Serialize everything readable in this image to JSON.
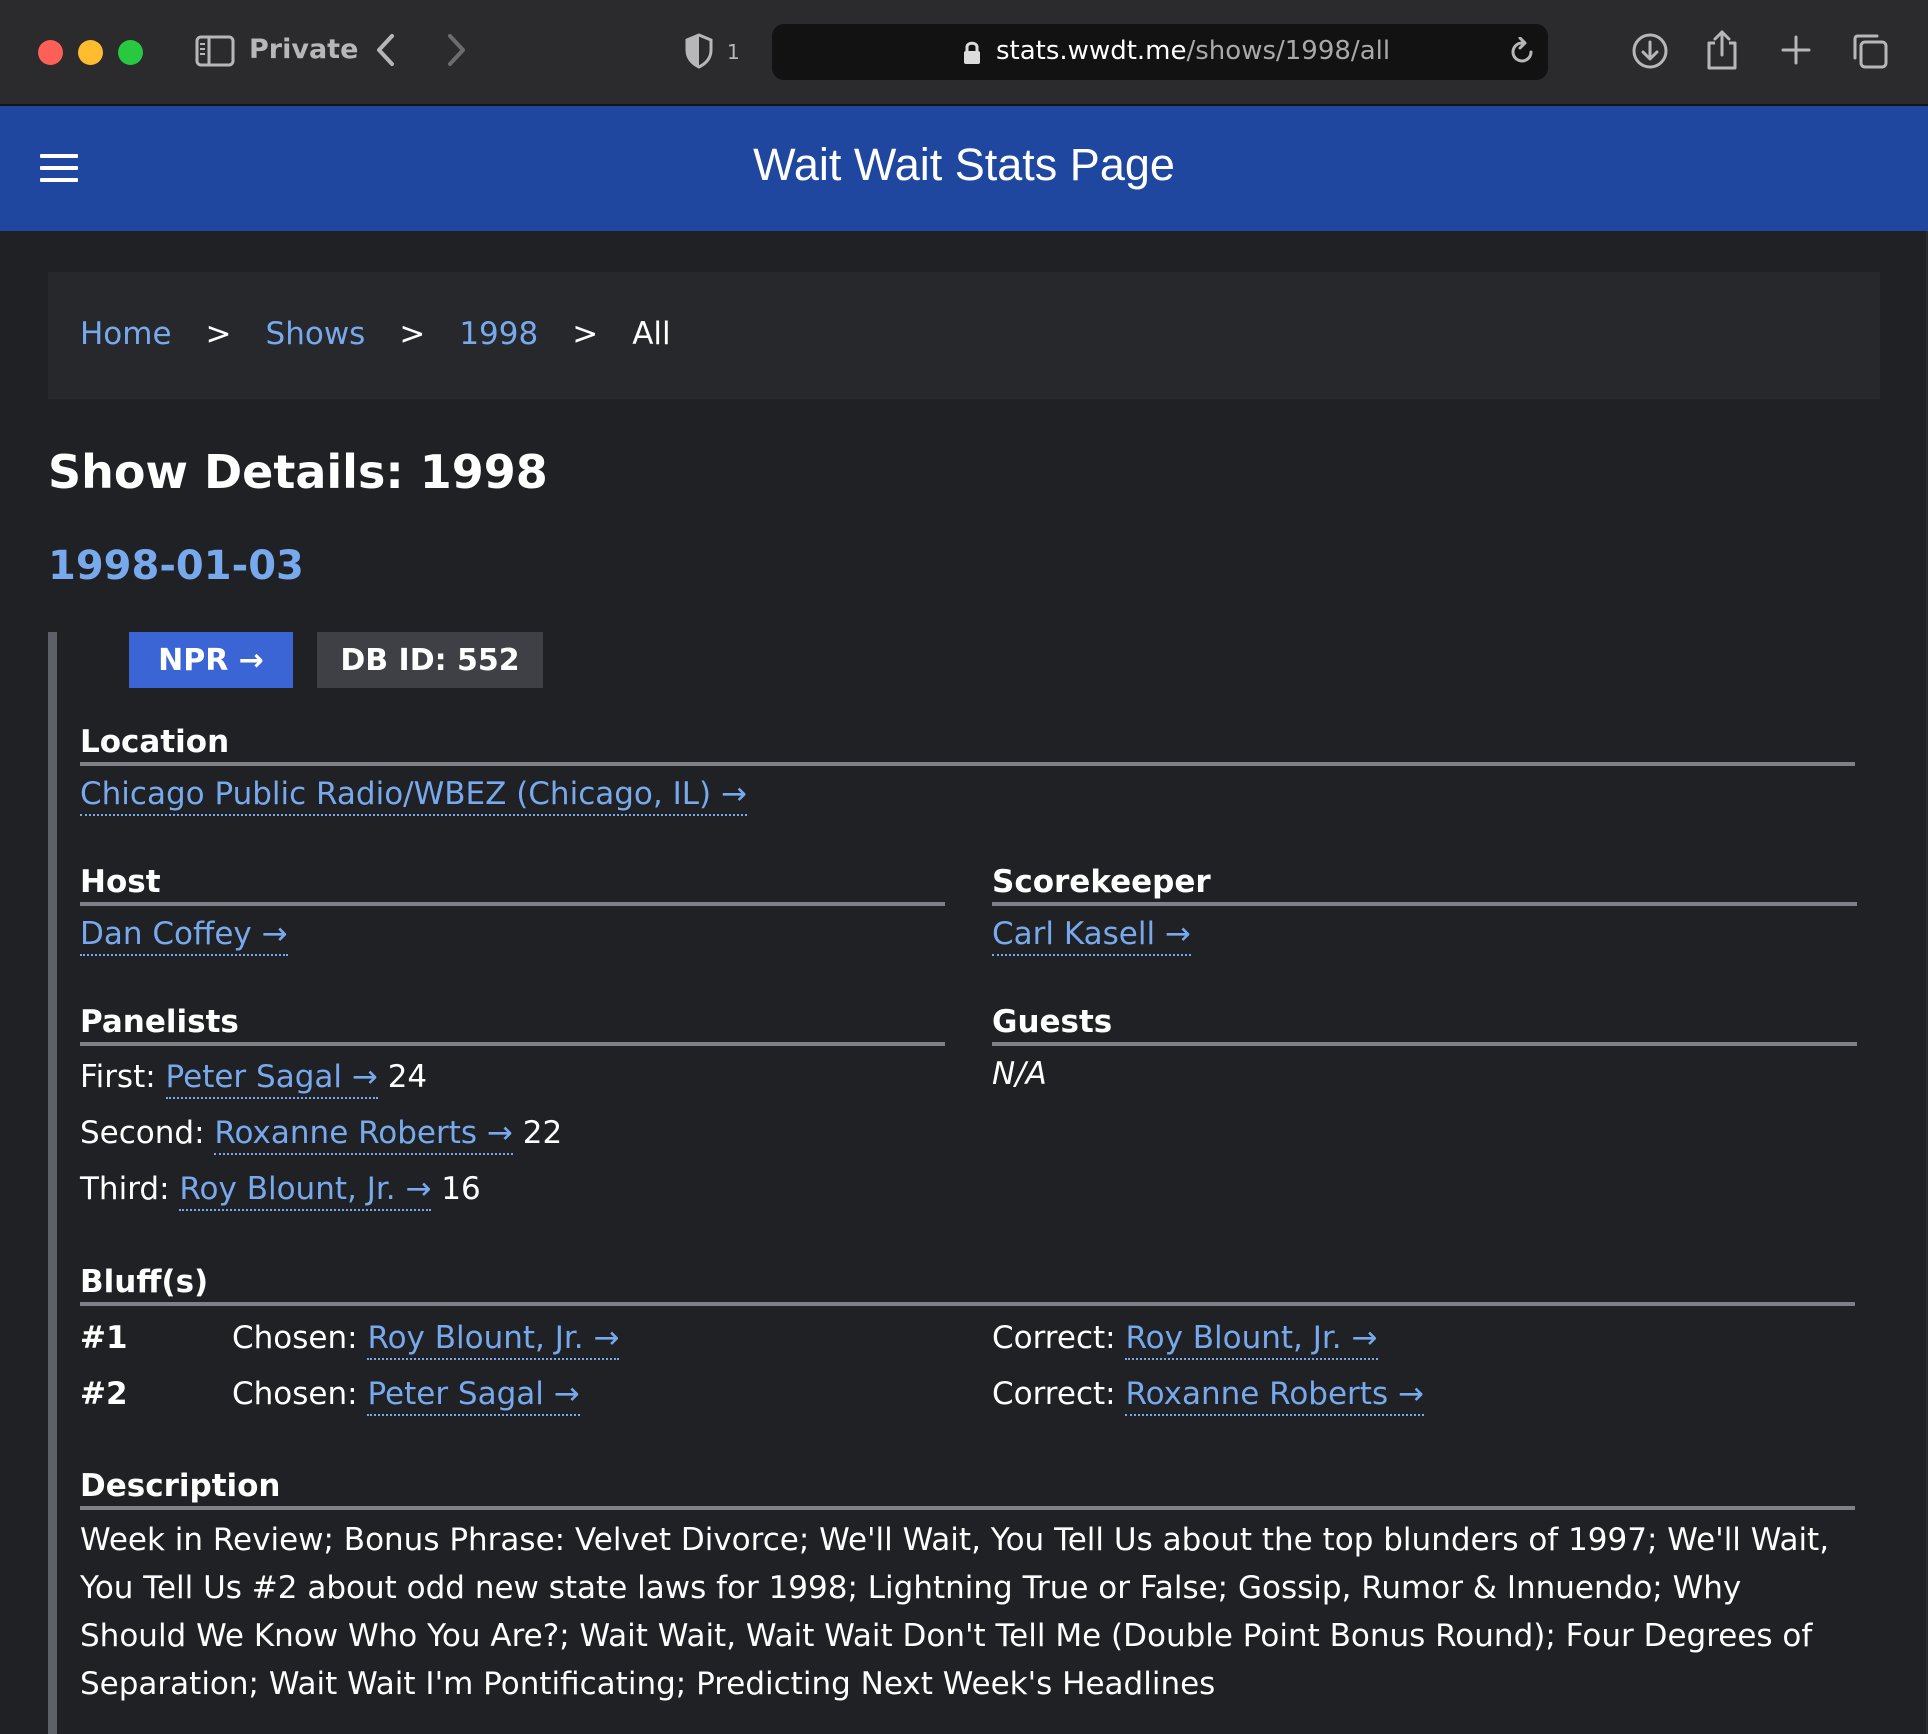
{
  "browser": {
    "private_label": "Private",
    "tracker_count": "1",
    "url_host": "stats.wwdt.me",
    "url_path": "/shows/1998/all"
  },
  "header": {
    "title": "Wait Wait Stats Page"
  },
  "breadcrumb": {
    "items": [
      "Home",
      "Shows",
      "1998"
    ],
    "separator": ">",
    "current": "All"
  },
  "page": {
    "title": "Show Details: 1998"
  },
  "show": {
    "date": "1998-01-03",
    "npr_label": "NPR →",
    "db_id_label": "DB ID: 552",
    "location": {
      "heading": "Location",
      "value": "Chicago Public Radio/WBEZ (Chicago, IL) →"
    },
    "host": {
      "heading": "Host",
      "value": "Dan Coffey →"
    },
    "scorekeeper": {
      "heading": "Scorekeeper",
      "value": "Carl Kasell →"
    },
    "panelists": {
      "heading": "Panelists",
      "items": [
        {
          "position": "First:",
          "name": "Peter Sagal →",
          "score": "24"
        },
        {
          "position": "Second:",
          "name": "Roxanne Roberts →",
          "score": "22"
        },
        {
          "position": "Third:",
          "name": "Roy Blount, Jr. →",
          "score": "16"
        }
      ]
    },
    "guests": {
      "heading": "Guests",
      "value": "N/A"
    },
    "bluffs": {
      "heading": "Bluff(s)",
      "chosen_label": "Chosen:",
      "correct_label": "Correct:",
      "items": [
        {
          "number": "#1",
          "chosen": "Roy Blount, Jr. →",
          "correct": "Roy Blount, Jr. →"
        },
        {
          "number": "#2",
          "chosen": "Peter Sagal →",
          "correct": "Roxanne Roberts →"
        }
      ]
    },
    "description": {
      "heading": "Description",
      "text": "Week in Review; Bonus Phrase: Velvet Divorce; We'll Wait, You Tell Us about the top blunders of 1997; We'll Wait, You Tell Us #2 about odd new state laws for 1998; Lightning True or False; Gossip, Rumor & Innuendo; Why Should We Know Who You Are?; Wait Wait, Wait Wait Don't Tell Me (Double Point Bonus Round); Four Degrees of Separation; Wait Wait I'm Pontificating; Predicting Next Week's Headlines"
    }
  },
  "colors": {
    "header_bg": "#1f47a0",
    "page_bg": "#202124",
    "link": "#78a9ec",
    "npr_button": "#3b64d4"
  }
}
